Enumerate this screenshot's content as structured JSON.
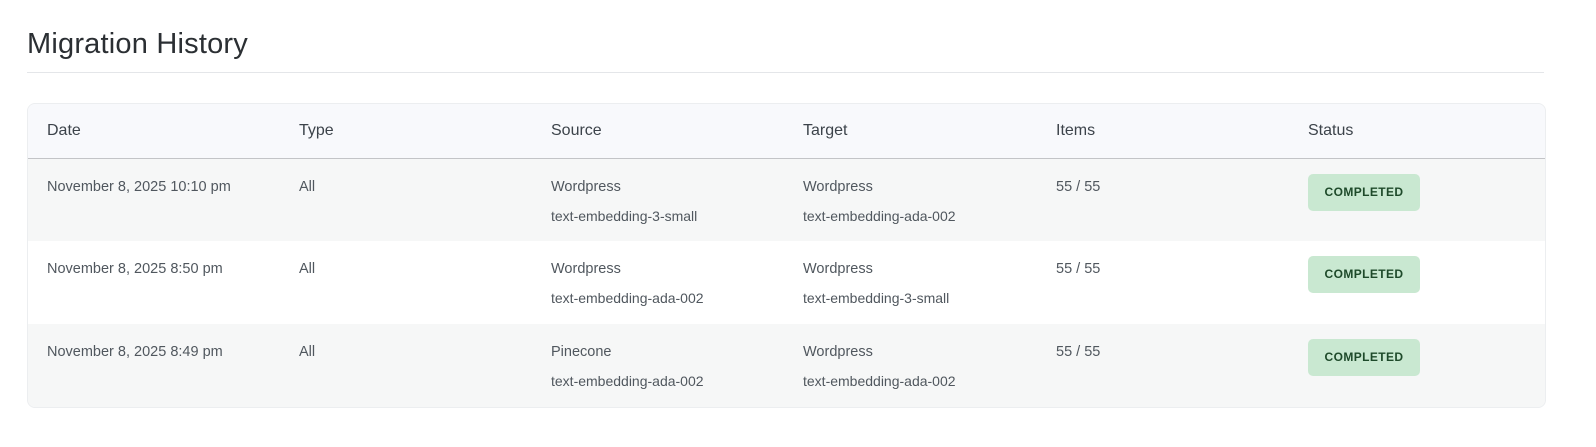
{
  "header": {
    "title": "Migration History"
  },
  "table": {
    "columns": [
      "Date",
      "Type",
      "Source",
      "Target",
      "Items",
      "Status"
    ],
    "rows": [
      {
        "date": "November 8, 2025 10:10 pm",
        "type": "All",
        "source": "Wordpress",
        "source_model": "text-embedding-3-small",
        "target": "Wordpress",
        "target_model": "text-embedding-ada-002",
        "items": "55 / 55",
        "status": "COMPLETED"
      },
      {
        "date": "November 8, 2025 8:50 pm",
        "type": "All",
        "source": "Wordpress",
        "source_model": "text-embedding-ada-002",
        "target": "Wordpress",
        "target_model": "text-embedding-3-small",
        "items": "55 / 55",
        "status": "COMPLETED"
      },
      {
        "date": "November 8, 2025 8:49 pm",
        "type": "All",
        "source": "Pinecone",
        "source_model": "text-embedding-ada-002",
        "target": "Wordpress",
        "target_model": "text-embedding-ada-002",
        "items": "55 / 55",
        "status": "COMPLETED"
      }
    ]
  },
  "colors": {
    "status_completed_bg": "#c9e8d1",
    "status_completed_text": "#1e4a2a"
  }
}
